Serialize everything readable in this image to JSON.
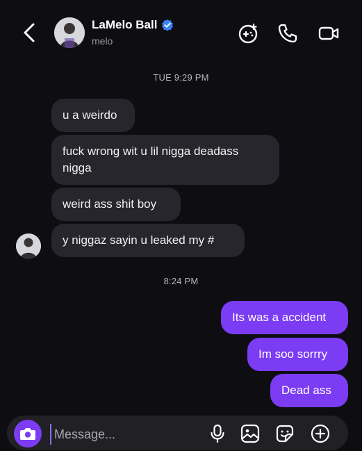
{
  "header": {
    "contact_name": "LaMelo Ball",
    "username": "melo",
    "icons": [
      "back-chevron-icon",
      "verified-badge-icon",
      "game-controller-icon",
      "phone-icon",
      "video-camera-icon"
    ]
  },
  "thread": {
    "timestamps": [
      "TUE 9:29 PM",
      "8:24 PM"
    ],
    "received": [
      "u a weirdo",
      "fuck wrong wit u lil nigga deadass",
      "nigga",
      "weird ass shit boy",
      "y niggaz sayin u leaked my #"
    ],
    "sent": [
      "Its was a accident",
      "Im soo sorrry",
      "Dead ass"
    ]
  },
  "composer": {
    "placeholder": "Message...",
    "icons": [
      "camera-icon",
      "microphone-icon",
      "image-icon",
      "sticker-icon",
      "plus-circle-icon"
    ]
  },
  "colors": {
    "background": "#0e0e12",
    "received_bubble": "#26262c",
    "sent_bubble": "#7b3cf3",
    "verified_blue": "#3b82f6"
  }
}
